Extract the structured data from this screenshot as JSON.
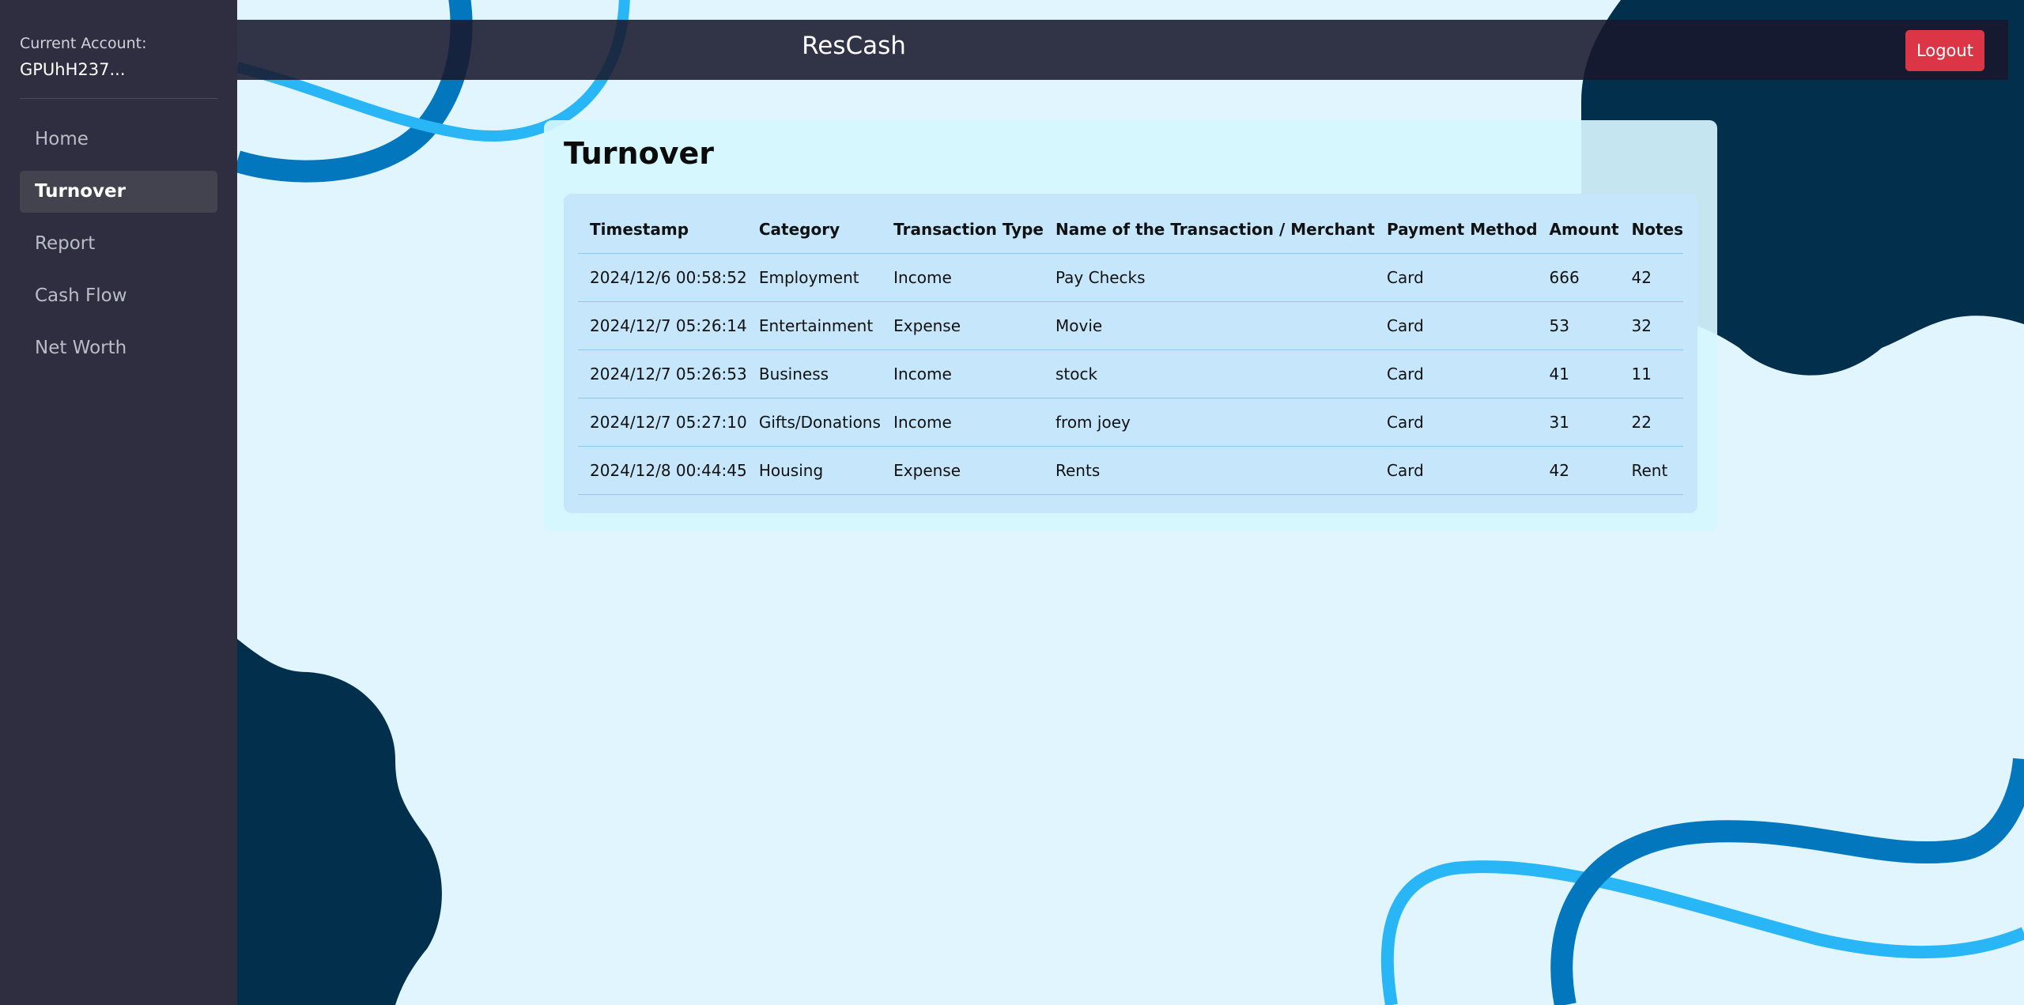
{
  "app_title": "ResCash",
  "sidebar": {
    "account_label": "Current Account:",
    "account_id": "GPUhH237...",
    "items": [
      {
        "label": "Home",
        "active": false
      },
      {
        "label": "Turnover",
        "active": true
      },
      {
        "label": "Report",
        "active": false
      },
      {
        "label": "Cash Flow",
        "active": false
      },
      {
        "label": "Net Worth",
        "active": false
      }
    ]
  },
  "header": {
    "logout_label": "Logout"
  },
  "main": {
    "title": "Turnover",
    "table": {
      "columns": [
        "Timestamp",
        "Category",
        "Transaction Type",
        "Name of the Transaction / Merchant",
        "Payment Method",
        "Amount",
        "Notes"
      ],
      "rows": [
        [
          "2024/12/6 00:58:52",
          "Employment",
          "Income",
          "Pay Checks",
          "Card",
          "666",
          "42"
        ],
        [
          "2024/12/7 05:26:14",
          "Entertainment",
          "Expense",
          "Movie",
          "Card",
          "53",
          "32"
        ],
        [
          "2024/12/7 05:26:53",
          "Business",
          "Income",
          "stock",
          "Card",
          "41",
          "11"
        ],
        [
          "2024/12/7 05:27:10",
          "Gifts/Donations",
          "Income",
          "from joey",
          "Card",
          "31",
          "22"
        ],
        [
          "2024/12/8 00:44:45",
          "Housing",
          "Expense",
          "Rents",
          "Card",
          "42",
          "Rent"
        ]
      ]
    }
  },
  "colors": {
    "sidebar_bg": "#2e2e40",
    "header_bg": "#18182c",
    "page_bg": "#e1f5fe",
    "logout_bg": "#dc3545",
    "blob": "#022f4b",
    "wave_dark": "#0277bd",
    "wave_light": "#29b6f6"
  }
}
